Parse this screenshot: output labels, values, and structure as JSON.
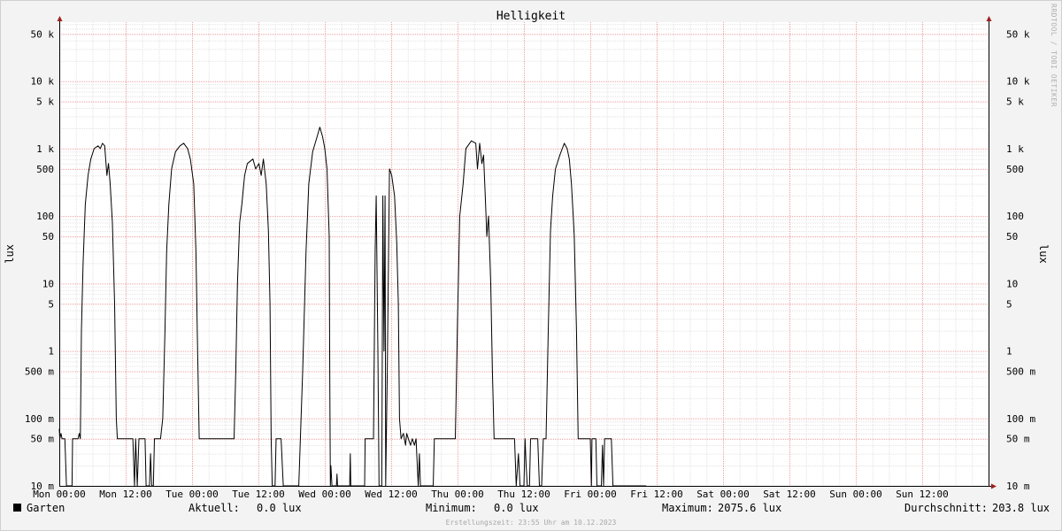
{
  "chart_data": {
    "type": "line",
    "title": "Helligkeit",
    "ylabel": "lux",
    "watermark": "RRDTOOL / TOBI OETIKER",
    "y_scale": "log",
    "ylim": [
      0.01,
      75000
    ],
    "grid": true,
    "y_ticks": [
      {
        "value": 0.01,
        "label": "10 m"
      },
      {
        "value": 0.05,
        "label": "50 m"
      },
      {
        "value": 0.1,
        "label": "100 m"
      },
      {
        "value": 0.5,
        "label": "500 m"
      },
      {
        "value": 1,
        "label": "1"
      },
      {
        "value": 5,
        "label": "5"
      },
      {
        "value": 10,
        "label": "10"
      },
      {
        "value": 50,
        "label": "50"
      },
      {
        "value": 100,
        "label": "100"
      },
      {
        "value": 500,
        "label": "500"
      },
      {
        "value": 1000,
        "label": "1 k"
      },
      {
        "value": 5000,
        "label": "5 k"
      },
      {
        "value": 10000,
        "label": "10 k"
      },
      {
        "value": 50000,
        "label": "50 k"
      }
    ],
    "x_range_hours": [
      0,
      168
    ],
    "x_ticks": [
      {
        "hour": 0,
        "label": "Mon 00:00"
      },
      {
        "hour": 12,
        "label": "Mon 12:00"
      },
      {
        "hour": 24,
        "label": "Tue 00:00"
      },
      {
        "hour": 36,
        "label": "Tue 12:00"
      },
      {
        "hour": 48,
        "label": "Wed 00:00"
      },
      {
        "hour": 60,
        "label": "Wed 12:00"
      },
      {
        "hour": 72,
        "label": "Thu 00:00"
      },
      {
        "hour": 84,
        "label": "Thu 12:00"
      },
      {
        "hour": 96,
        "label": "Fri 00:00"
      },
      {
        "hour": 108,
        "label": "Fri 12:00"
      },
      {
        "hour": 120,
        "label": "Sat 00:00"
      },
      {
        "hour": 132,
        "label": "Sat 12:00"
      },
      {
        "hour": 144,
        "label": "Sun 00:00"
      },
      {
        "hour": 156,
        "label": "Sun 12:00"
      }
    ],
    "series": [
      {
        "name": "Garten",
        "color": "#000000",
        "points": [
          [
            0.0,
            0.07
          ],
          [
            0.1,
            0.05
          ],
          [
            0.3,
            0.06
          ],
          [
            0.5,
            0.05
          ],
          [
            1.0,
            0.05
          ],
          [
            1.3,
            0.01
          ],
          [
            2.3,
            0.01
          ],
          [
            2.4,
            0.05
          ],
          [
            3.4,
            0.05
          ],
          [
            3.6,
            0.06
          ],
          [
            3.8,
            0.05
          ],
          [
            4.0,
            2
          ],
          [
            4.3,
            20
          ],
          [
            4.7,
            150
          ],
          [
            5.2,
            400
          ],
          [
            5.7,
            700
          ],
          [
            6.3,
            1000
          ],
          [
            7.0,
            1100
          ],
          [
            7.4,
            1000
          ],
          [
            7.8,
            1200
          ],
          [
            8.2,
            1100
          ],
          [
            8.6,
            400
          ],
          [
            8.9,
            600
          ],
          [
            9.2,
            300
          ],
          [
            9.6,
            80
          ],
          [
            10.0,
            5
          ],
          [
            10.3,
            0.1
          ],
          [
            10.5,
            0.05
          ],
          [
            13.3,
            0.05
          ],
          [
            13.6,
            0.01
          ],
          [
            13.8,
            0.05
          ],
          [
            14.1,
            0.01
          ],
          [
            14.4,
            0.05
          ],
          [
            15.5,
            0.05
          ],
          [
            15.7,
            0.01
          ],
          [
            16.3,
            0.01
          ],
          [
            16.5,
            0.03
          ],
          [
            16.7,
            0.01
          ],
          [
            17.0,
            0.01
          ],
          [
            17.2,
            0.05
          ],
          [
            18.3,
            0.05
          ],
          [
            18.7,
            0.1
          ],
          [
            19.1,
            2
          ],
          [
            19.4,
            30
          ],
          [
            19.8,
            150
          ],
          [
            20.3,
            500
          ],
          [
            21.0,
            900
          ],
          [
            21.8,
            1100
          ],
          [
            22.5,
            1200
          ],
          [
            23.2,
            1000
          ],
          [
            23.7,
            700
          ],
          [
            24.3,
            300
          ],
          [
            24.7,
            30
          ],
          [
            25.0,
            1
          ],
          [
            25.3,
            0.05
          ],
          [
            31.6,
            0.05
          ],
          [
            31.9,
            0.5
          ],
          [
            32.2,
            10
          ],
          [
            32.6,
            80
          ],
          [
            33.0,
            150
          ],
          [
            33.5,
            400
          ],
          [
            34.0,
            600
          ],
          [
            35.0,
            700
          ],
          [
            35.5,
            500
          ],
          [
            36.1,
            600
          ],
          [
            36.5,
            400
          ],
          [
            36.9,
            700
          ],
          [
            37.4,
            300
          ],
          [
            37.8,
            60
          ],
          [
            38.1,
            5
          ],
          [
            38.3,
            0.05
          ],
          [
            38.5,
            0.01
          ],
          [
            39.0,
            0.01
          ],
          [
            39.2,
            0.05
          ],
          [
            40.1,
            0.05
          ],
          [
            40.5,
            0.01
          ],
          [
            43.3,
            0.01
          ],
          [
            44.0,
            0.5
          ],
          [
            44.6,
            30
          ],
          [
            45.1,
            300
          ],
          [
            45.8,
            900
          ],
          [
            46.6,
            1500
          ],
          [
            47.1,
            2075.6
          ],
          [
            47.6,
            1500
          ],
          [
            48.0,
            1000
          ],
          [
            48.4,
            500
          ],
          [
            48.8,
            50
          ],
          [
            48.9,
            0.5
          ],
          [
            49.0,
            0.01
          ],
          [
            49.1,
            0.02
          ],
          [
            49.3,
            0.01
          ],
          [
            50.1,
            0.01
          ],
          [
            50.2,
            0.015
          ],
          [
            50.3,
            0.01
          ],
          [
            52.5,
            0.01
          ],
          [
            52.6,
            0.03
          ],
          [
            52.7,
            0.01
          ],
          [
            55.2,
            0.01
          ],
          [
            55.3,
            0.05
          ],
          [
            56.8,
            0.05
          ],
          [
            57.1,
            30
          ],
          [
            57.3,
            200
          ],
          [
            57.6,
            1
          ],
          [
            57.8,
            0.01
          ],
          [
            58.3,
            0.01
          ],
          [
            58.5,
            200
          ],
          [
            58.7,
            1
          ],
          [
            58.9,
            200
          ],
          [
            59.0,
            0.01
          ],
          [
            59.3,
            0.5
          ],
          [
            59.7,
            500
          ],
          [
            60.1,
            400
          ],
          [
            60.6,
            200
          ],
          [
            61.0,
            40
          ],
          [
            61.3,
            5
          ],
          [
            61.5,
            0.1
          ],
          [
            61.8,
            0.05
          ],
          [
            62.2,
            0.06
          ],
          [
            62.6,
            0.04
          ],
          [
            62.8,
            0.06
          ],
          [
            63.1,
            0.05
          ],
          [
            63.5,
            0.04
          ],
          [
            63.8,
            0.05
          ],
          [
            64.2,
            0.04
          ],
          [
            64.5,
            0.05
          ],
          [
            64.9,
            0.01
          ],
          [
            65.1,
            0.03
          ],
          [
            65.3,
            0.01
          ],
          [
            67.6,
            0.01
          ],
          [
            67.8,
            0.05
          ],
          [
            71.6,
            0.05
          ],
          [
            72.0,
            3
          ],
          [
            72.4,
            100
          ],
          [
            73.0,
            300
          ],
          [
            73.5,
            1000
          ],
          [
            74.5,
            1300
          ],
          [
            75.3,
            1200
          ],
          [
            75.6,
            500
          ],
          [
            76.0,
            1200
          ],
          [
            76.4,
            600
          ],
          [
            76.7,
            800
          ],
          [
            77.0,
            200
          ],
          [
            77.3,
            50
          ],
          [
            77.6,
            100
          ],
          [
            78.0,
            10
          ],
          [
            78.3,
            0.5
          ],
          [
            78.6,
            0.05
          ],
          [
            82.3,
            0.05
          ],
          [
            82.6,
            0.01
          ],
          [
            83.0,
            0.03
          ],
          [
            83.3,
            0.01
          ],
          [
            84.0,
            0.01
          ],
          [
            84.2,
            0.05
          ],
          [
            84.4,
            0.02
          ],
          [
            84.6,
            0.01
          ],
          [
            85.0,
            0.01
          ],
          [
            85.2,
            0.05
          ],
          [
            86.5,
            0.05
          ],
          [
            86.8,
            0.01
          ],
          [
            87.2,
            0.01
          ],
          [
            87.5,
            0.05
          ],
          [
            88.0,
            0.05
          ],
          [
            88.4,
            2
          ],
          [
            88.8,
            60
          ],
          [
            89.2,
            200
          ],
          [
            89.7,
            500
          ],
          [
            90.5,
            800
          ],
          [
            91.3,
            1200
          ],
          [
            91.8,
            1000
          ],
          [
            92.2,
            700
          ],
          [
            92.6,
            300
          ],
          [
            93.1,
            50
          ],
          [
            93.5,
            2
          ],
          [
            93.8,
            0.05
          ],
          [
            96.0,
            0.05
          ],
          [
            96.2,
            0.01
          ],
          [
            96.3,
            0.05
          ],
          [
            97.0,
            0.05
          ],
          [
            97.2,
            0.01
          ],
          [
            98.0,
            0.01
          ],
          [
            98.2,
            0.04
          ],
          [
            98.4,
            0.01
          ],
          [
            98.6,
            0.05
          ],
          [
            99.8,
            0.05
          ],
          [
            100.1,
            0.01
          ],
          [
            106.1,
            0.01
          ]
        ]
      }
    ],
    "legend": {
      "entries": [
        {
          "label": "Garten",
          "color": "#000000"
        }
      ],
      "aktuell_label": "Aktuell:",
      "aktuell_value": "0.0 lux",
      "minimum_label": "Minimum:",
      "minimum_value": "0.0 lux",
      "maximum_label": "Maximum:",
      "maximum_value": "2075.6 lux",
      "durchschnitt_label": "Durchschnitt:",
      "durchschnitt_value": "203.8 lux"
    },
    "footer": "Erstellungszeit: 23:55 Uhr am 10.12.2023"
  }
}
